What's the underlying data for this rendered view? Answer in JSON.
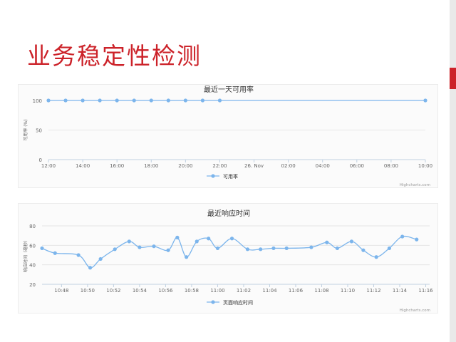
{
  "slide": {
    "title": "业务稳定性检测"
  },
  "colors": {
    "series": "#7cb5ec",
    "title_red": "#cc2229",
    "grid": "#e6e6e6",
    "axis": "#c0d0e0"
  },
  "chart_data": [
    {
      "type": "line",
      "title": "最近一天可用率",
      "ylabel": "可用率 (%)",
      "xlabel": "",
      "ylim": [
        0,
        100
      ],
      "y_ticks": [
        0,
        50,
        100
      ],
      "x_ticks": [
        "12:00",
        "14:00",
        "16:00",
        "18:00",
        "20:00",
        "22:00",
        "26. Nov",
        "02:00",
        "04:00",
        "06:00",
        "08:00",
        "10:00"
      ],
      "x": [
        "12:00",
        "13:00",
        "14:00",
        "15:00",
        "16:00",
        "17:00",
        "18:00",
        "19:00",
        "20:00",
        "21:00",
        "22:00",
        "10:00"
      ],
      "x_hours": [
        0,
        1,
        2,
        3,
        4,
        5,
        6,
        7,
        8,
        9,
        10,
        22
      ],
      "x_range_hours": [
        0,
        22
      ],
      "series": [
        {
          "name": "可用率",
          "values": [
            100,
            100,
            100,
            100,
            100,
            100,
            100,
            100,
            100,
            100,
            100,
            100
          ]
        }
      ],
      "legend": "bottom-center",
      "credits": "Highcharts.com",
      "grid": true
    },
    {
      "type": "line",
      "title": "最近响应时间",
      "ylabel": "响应时间（毫秒）",
      "xlabel": "",
      "ylim": [
        20,
        80
      ],
      "y_ticks": [
        20,
        40,
        60,
        80
      ],
      "x_ticks": [
        "10:48",
        "10:50",
        "10:52",
        "10:54",
        "10:56",
        "10:58",
        "11:00",
        "11:02",
        "11:04",
        "11:06",
        "11:08",
        "11:10",
        "11:12",
        "11:14",
        "11:16"
      ],
      "x_minutes": [
        46.5,
        47.5,
        49.3,
        50.2,
        51.0,
        52.1,
        53.2,
        54.0,
        55.1,
        56.2,
        56.9,
        57.6,
        58.4,
        59.3,
        60.0,
        61.1,
        62.3,
        63.3,
        64.3,
        65.3,
        67.2,
        68.4,
        69.2,
        70.3,
        71.2,
        72.2,
        73.2,
        74.2,
        75.3
      ],
      "x_range_minutes": [
        46.5,
        76.3
      ],
      "series": [
        {
          "name": "页面响应时间",
          "values": [
            57,
            52,
            50,
            37,
            46,
            56,
            64,
            58,
            59,
            55,
            68,
            48,
            64,
            67,
            57,
            67,
            56,
            56,
            57,
            57,
            58,
            63,
            57,
            64,
            55,
            48,
            57,
            69,
            66
          ]
        }
      ],
      "legend": "bottom-center",
      "credits": "Highcharts.com",
      "grid": true
    }
  ]
}
